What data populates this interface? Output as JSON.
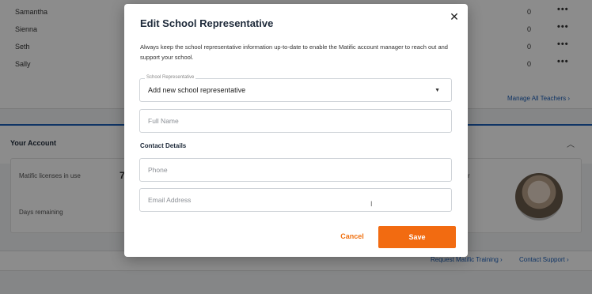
{
  "teachers": [
    {
      "name": "Samantha",
      "count": "0",
      "more": "•••"
    },
    {
      "name": "Sienna",
      "count": "0",
      "more": "•••"
    },
    {
      "name": "Seth",
      "count": "0",
      "more": "•••"
    },
    {
      "name": "Sally",
      "count": "0",
      "more": "•••"
    }
  ],
  "manage_link": "Manage All Teachers ›",
  "account": {
    "title": "Your Account",
    "licenses_label": "Matific licenses in use",
    "licenses_value": "7",
    "days_label": "Days remaining",
    "right_text": "r"
  },
  "footer_links": {
    "training": "Request Matific Training ›",
    "support": "Contact Support ›"
  },
  "modal": {
    "title": "Edit School Representative",
    "close": "✕",
    "description": "Always keep the school representative information up-to-date to enable the Matific account manager to reach out and support your school.",
    "rep_legend": "School Representative",
    "rep_value": "Add new school representative",
    "rep_caret": "▼",
    "full_name_placeholder": "Full Name",
    "contact_label": "Contact Details",
    "phone_placeholder": "Phone",
    "email_placeholder": "Email Address",
    "cancel_label": "Cancel",
    "save_label": "Save",
    "accent_color": "#f26b11"
  }
}
